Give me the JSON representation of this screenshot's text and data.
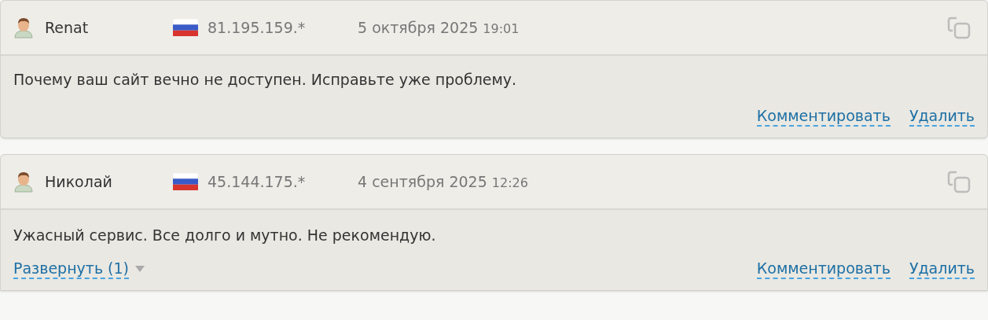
{
  "comments": [
    {
      "author": "Renat",
      "ip": "81.195.159.*",
      "date": "5 октября 2025",
      "time": "19:01",
      "text": "Почему ваш сайт вечно не доступен. Исправьте уже проблему.",
      "actions": [
        "Комментировать",
        "Удалить"
      ]
    },
    {
      "author": "Николай",
      "ip": "45.144.175.*",
      "date": "4 сентября 2025",
      "time": "12:26",
      "text": "Ужасный сервис. Все долго и мутно. Не рекомендую.",
      "expand": "Развернуть (1)",
      "actions": [
        "Комментировать",
        "Удалить"
      ]
    }
  ]
}
